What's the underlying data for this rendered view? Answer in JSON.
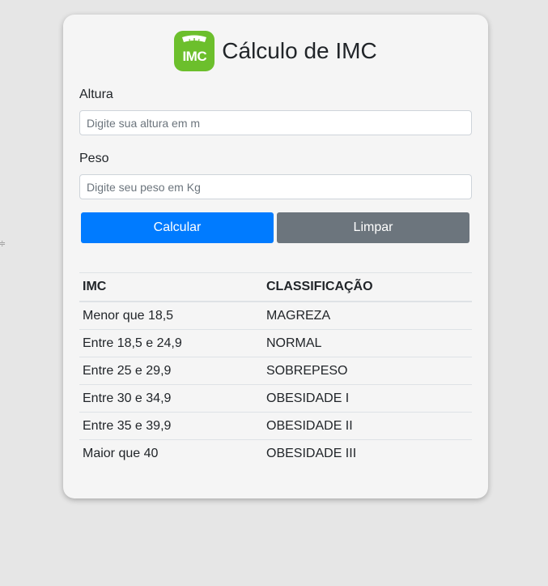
{
  "stray_glyph": "≑",
  "header": {
    "logo_text": "IMC",
    "title": "Cálculo de IMC"
  },
  "form": {
    "altura": {
      "label": "Altura",
      "placeholder": "Digite sua altura em m",
      "value": ""
    },
    "peso": {
      "label": "Peso",
      "placeholder": "Digite seu peso em Kg",
      "value": ""
    }
  },
  "buttons": {
    "calcular": "Calcular",
    "limpar": "Limpar"
  },
  "table": {
    "headers": [
      "IMC",
      "CLASSIFICAÇÃO"
    ],
    "rows": [
      [
        "Menor que 18,5",
        "MAGREZA"
      ],
      [
        "Entre 18,5 e 24,9",
        "NORMAL"
      ],
      [
        "Entre 25 e 29,9",
        "SOBREPESO"
      ],
      [
        "Entre 30 e 34,9",
        "OBESIDADE I"
      ],
      [
        "Entre 35 e 39,9",
        "OBESIDADE II"
      ],
      [
        "Maior que 40",
        "OBESIDADE III"
      ]
    ]
  },
  "colors": {
    "background": "#e6e6e6",
    "card": "#f5f5f5",
    "primary": "#007bff",
    "secondary": "#6c757d",
    "logo": "#6cbf2c"
  }
}
